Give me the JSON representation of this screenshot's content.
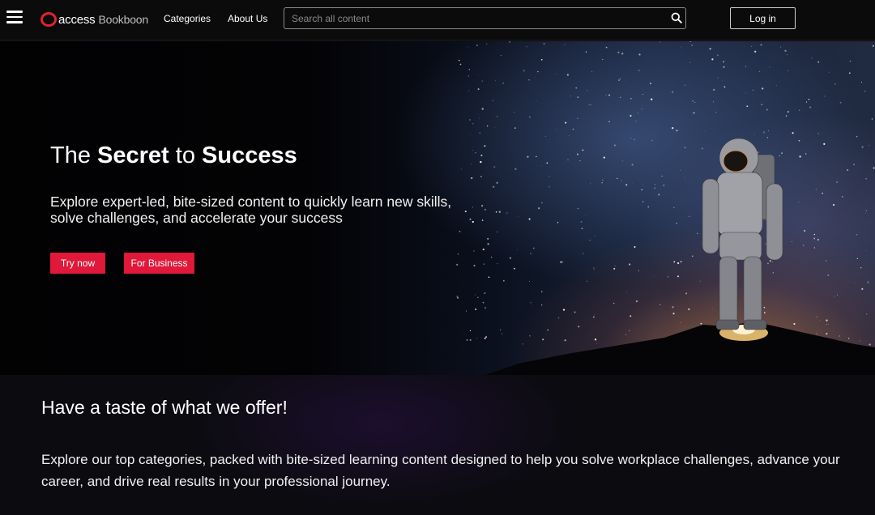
{
  "nav": {
    "brand_primary": "access",
    "brand_secondary": "Bookboon",
    "links": [
      "Categories",
      "About Us"
    ],
    "search_placeholder": "Search all content",
    "login_label": "Log in"
  },
  "hero": {
    "title_part1": "The ",
    "title_bold1": "Secret",
    "title_part2": " to ",
    "title_bold2": "Success",
    "subtitle": "Explore expert-led, bite-sized content to quickly learn new skills, solve challenges, and accelerate your success",
    "buttons": [
      "Try now",
      "For Business"
    ]
  },
  "offer": {
    "title": "Have a taste of what we offer!",
    "text": "Explore our top categories, packed with bite-sized learning content designed to help you solve workplace challenges, advance your career, and drive real results in your professional journey."
  },
  "colors": {
    "accent": "#e0193a",
    "brand_ring": "#e1232f",
    "nav_bg": "#0b0b0b"
  },
  "icons": {
    "menu": "hamburger-icon",
    "search": "search-icon",
    "logo": "access-logo-ring"
  }
}
